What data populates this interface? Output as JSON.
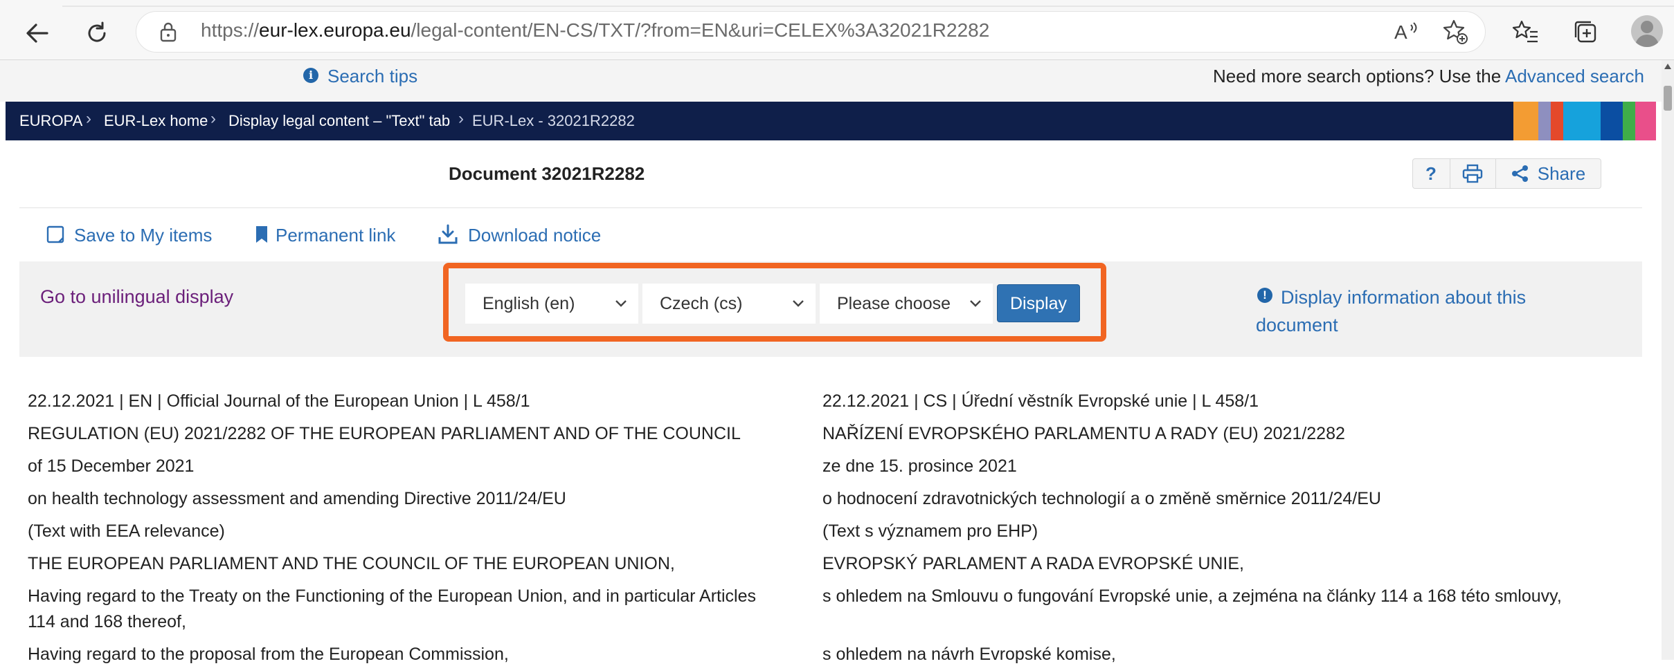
{
  "browser": {
    "url_prefix": "https://",
    "url_domain": "eur-lex.europa.eu",
    "url_path": "/legal-content/EN-CS/TXT/?from=EN&uri=CELEX%3A32021R2282"
  },
  "top": {
    "search_tips": "Search tips",
    "more_search_prefix": "Need more search options? Use the ",
    "advanced_search": "Advanced search"
  },
  "breadcrumb": [
    "EUROPA",
    "EUR-Lex home",
    "Display legal content – \"Text\" tab",
    "EUR-Lex - 32021R2282"
  ],
  "stripe_colors": [
    "#f39c33",
    "#8e8fbf",
    "#e4492b",
    "#16a2dc",
    "#0b4ea2",
    "#3fae49",
    "#e94f8a"
  ],
  "document": {
    "title": "Document 32021R2282",
    "help": "?",
    "share": "Share"
  },
  "actions": {
    "save": "Save to My items",
    "permalink": "Permanent link",
    "download": "Download notice"
  },
  "lang_panel": {
    "unilingual": "Go to unilingual display",
    "select1": "English (en)",
    "select2": "Czech (cs)",
    "select3": "Please choose",
    "display_btn": "Display",
    "doc_info_line1": "Display information about this",
    "doc_info_line2": "document"
  },
  "text_en": [
    "22.12.2021    | EN | Official Journal of the European Union | L 458/1",
    "REGULATION (EU) 2021/2282 OF THE EUROPEAN PARLIAMENT AND OF THE COUNCIL",
    "of 15 December 2021",
    "on health technology assessment and amending Directive 2011/24/EU",
    "(Text with EEA relevance)",
    "THE EUROPEAN PARLIAMENT AND THE COUNCIL OF THE EUROPEAN UNION,",
    "Having regard to the Treaty on the Functioning of the European Union, and in particular Articles",
    "114 and 168 thereof,",
    "Having regard to the proposal from the European Commission,"
  ],
  "text_cs": [
    "22.12.2021    | CS | Úřední věstník Evropské unie | L 458/1",
    "NAŘÍZENÍ EVROPSKÉHO PARLAMENTU A RADY (EU) 2021/2282",
    "ze dne 15. prosince 2021",
    "o hodnocení zdravotnických technologií a o změně směrnice 2011/24/EU",
    "(Text s významem pro EHP)",
    "EVROPSKÝ PARLAMENT A RADA EVROPSKÉ UNIE,",
    "s ohledem na Smlouvu o fungování Evropské unie, a zejména na články 114 a 168 této smlouvy,",
    "s ohledem na návrh Evropské komise,"
  ]
}
